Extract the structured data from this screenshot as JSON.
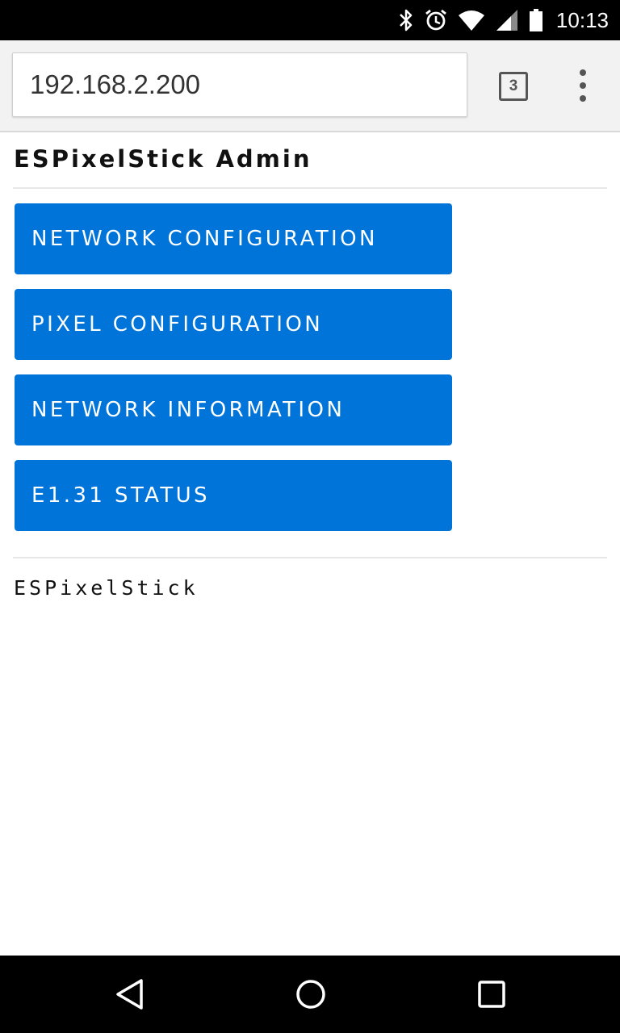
{
  "status_bar": {
    "time": "10:13",
    "icons": [
      "bluetooth-icon",
      "alarm-icon",
      "wifi-icon",
      "cell-signal-icon",
      "battery-icon"
    ]
  },
  "browser": {
    "url": "192.168.2.200",
    "tab_count": "3",
    "menu_icon": "overflow-menu-icon"
  },
  "page": {
    "title": "ESPixelStick Admin",
    "buttons": [
      {
        "label": "NETWORK CONFIGURATION"
      },
      {
        "label": "PIXEL CONFIGURATION"
      },
      {
        "label": "NETWORK INFORMATION"
      },
      {
        "label": "E1.31 STATUS"
      }
    ],
    "footer": "ESPixelStick",
    "accent_color": "#0074d9"
  },
  "nav_bar": {
    "icons": [
      "back-icon",
      "home-icon",
      "recents-icon"
    ]
  }
}
